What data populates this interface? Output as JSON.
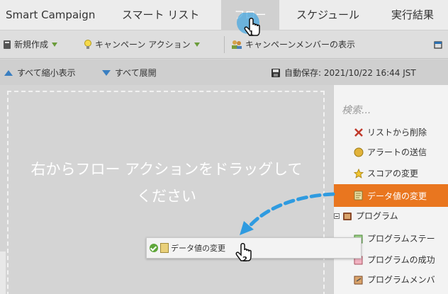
{
  "tabs": [
    "Smart Campaign",
    "スマート リスト",
    "フロー",
    "スケジュール",
    "実行結果"
  ],
  "active_tab": "フロー",
  "toolbar": {
    "new_label": "新規作成",
    "campaign_actions_label": "キャンペーン アクション",
    "show_members_label": "キャンペーンメンバーの表示"
  },
  "subbar": {
    "collapse_all": "すべて縮小表示",
    "expand_all": "すべて展開",
    "autosave": "自動保存: 2021/10/22 16:44 JST"
  },
  "canvas": {
    "hint_line1": "右からフロー アクションをドラッグして",
    "hint_line2": "ください"
  },
  "palette": {
    "search_placeholder": "検索...",
    "items": [
      {
        "label": "リストから削除",
        "icon": "remove-from-list-icon"
      },
      {
        "label": "アラートの送信",
        "icon": "alert-icon"
      },
      {
        "label": "スコアの変更",
        "icon": "star-icon"
      },
      {
        "label": "データ値の変更",
        "icon": "data-value-icon"
      },
      {
        "label": "プログラム",
        "icon": "program-folder-icon"
      },
      {
        "label": "プログラムステー",
        "icon": "program-status-icon"
      },
      {
        "label": "プログラムの成功",
        "icon": "program-success-icon"
      },
      {
        "label": "プログラムメンバ",
        "icon": "program-member-icon"
      }
    ]
  },
  "drag_chip": {
    "label": "データ値の変更"
  },
  "step_badges": [
    "1",
    "2"
  ],
  "colors": {
    "highlight": "#e9761f",
    "arrow": "#2f9be0",
    "accent_blue": "#3a7fc1"
  }
}
